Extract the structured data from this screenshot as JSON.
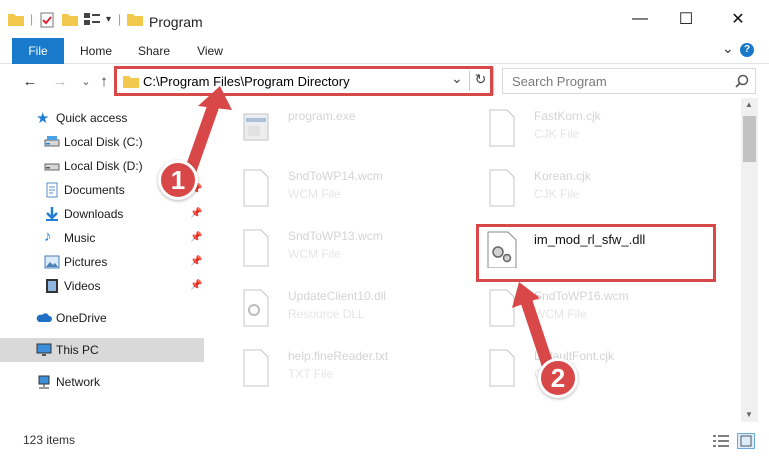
{
  "window": {
    "title": "Program",
    "minimize_glyph": "—",
    "maximize_glyph": "☐",
    "close_glyph": "✕"
  },
  "ribbon": {
    "tabs": [
      {
        "label": "File"
      },
      {
        "label": "Home"
      },
      {
        "label": "Share"
      },
      {
        "label": "View"
      }
    ],
    "expand_glyph": "⌄",
    "help_glyph": "?"
  },
  "navigation": {
    "back_glyph": "←",
    "forward_glyph": "→",
    "recent_glyph": "⌄",
    "up_glyph": "↑"
  },
  "address": {
    "path": "C:\\Program Files\\Program Directory",
    "dropdown_glyph": "⌄",
    "refresh_glyph": "↻"
  },
  "search": {
    "placeholder": "Search Program"
  },
  "sidebar": {
    "items": [
      {
        "label": "Quick access",
        "icon": "star-icon"
      },
      {
        "label": "Local Disk (C:)",
        "icon": "drive-icon"
      },
      {
        "label": "Local Disk (D:)",
        "icon": "drive-icon"
      },
      {
        "label": "Documents",
        "icon": "documents-icon"
      },
      {
        "label": "Downloads",
        "icon": "downloads-icon"
      },
      {
        "label": "Music",
        "icon": "music-icon"
      },
      {
        "label": "Pictures",
        "icon": "pictures-icon"
      },
      {
        "label": "Videos",
        "icon": "videos-icon"
      },
      {
        "label": "OneDrive",
        "icon": "cloud-icon"
      },
      {
        "label": "This PC",
        "icon": "computer-icon"
      },
      {
        "label": "Network",
        "icon": "network-icon"
      }
    ]
  },
  "files": [
    {
      "name": "program.exe",
      "type": ""
    },
    {
      "name": "FastKorn.cjk",
      "type": "CJK File"
    },
    {
      "name": "SndToWP14.wcm",
      "type": "WCM File"
    },
    {
      "name": "Korean.cjk",
      "type": "CJK File"
    },
    {
      "name": "SndToWP13.wcm",
      "type": "WCM File"
    },
    {
      "name": "im_mod_rl_sfw_.dll",
      "type": ""
    },
    {
      "name": "UpdateClient10.dll",
      "type": "Resource DLL"
    },
    {
      "name": "SndToWP16.wcm",
      "type": "WCM File"
    },
    {
      "name": "help.fineReader.txt",
      "type": "TXT File"
    },
    {
      "name": "DefaultFont.cjk",
      "type": "CJK File"
    }
  ],
  "status": {
    "item_count": "123 items"
  },
  "annotations": {
    "step1": "1",
    "step2": "2",
    "color": "#d94848"
  }
}
